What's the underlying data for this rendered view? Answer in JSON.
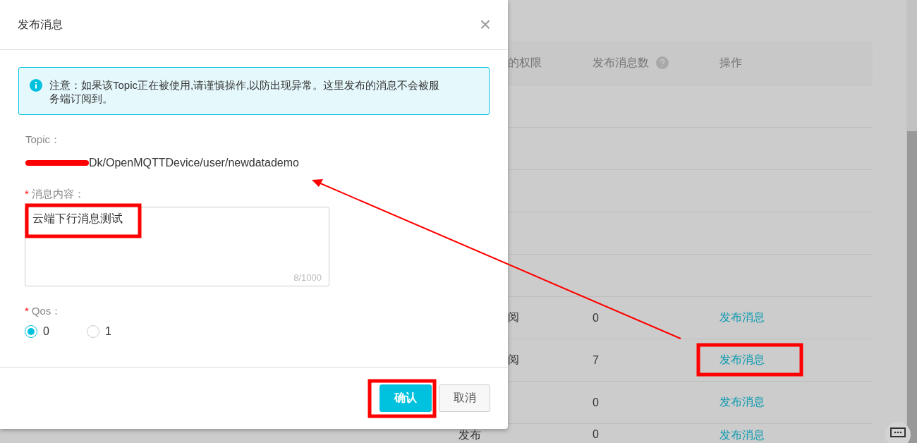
{
  "table": {
    "columns": [
      "的权限",
      "发布消息数",
      "操作"
    ],
    "rows": [
      {
        "permission": "阅",
        "published_count": "0",
        "action": "发布消息"
      },
      {
        "permission": "阅",
        "published_count": "7",
        "action": "发布消息"
      },
      {
        "published_count": "0",
        "action": "发布消息"
      },
      {
        "permission": "发布",
        "published_count": "0",
        "action": "发布消息"
      }
    ]
  },
  "dialog": {
    "title": "发布消息",
    "close": "×",
    "alert": "注意：如果该Topic正在被使用,请谨慎操作,以防出现异常。这里发布的消息不会被服务端订阅到。",
    "topic_label": "Topic：",
    "topic_value": "Dk/OpenMQTTDevice/user/newdatademo",
    "required_mark": "*",
    "content_label": "消息内容：",
    "content_value": "云端下行消息测试",
    "counter": "8/1000",
    "qos_label": "Qos：",
    "qos_options": [
      {
        "label": "0",
        "selected": true
      },
      {
        "label": "1",
        "selected": false
      }
    ],
    "buttons": [
      {
        "label": "确认",
        "kind": "primary"
      },
      {
        "label": "取消",
        "kind": "secondary"
      }
    ]
  }
}
